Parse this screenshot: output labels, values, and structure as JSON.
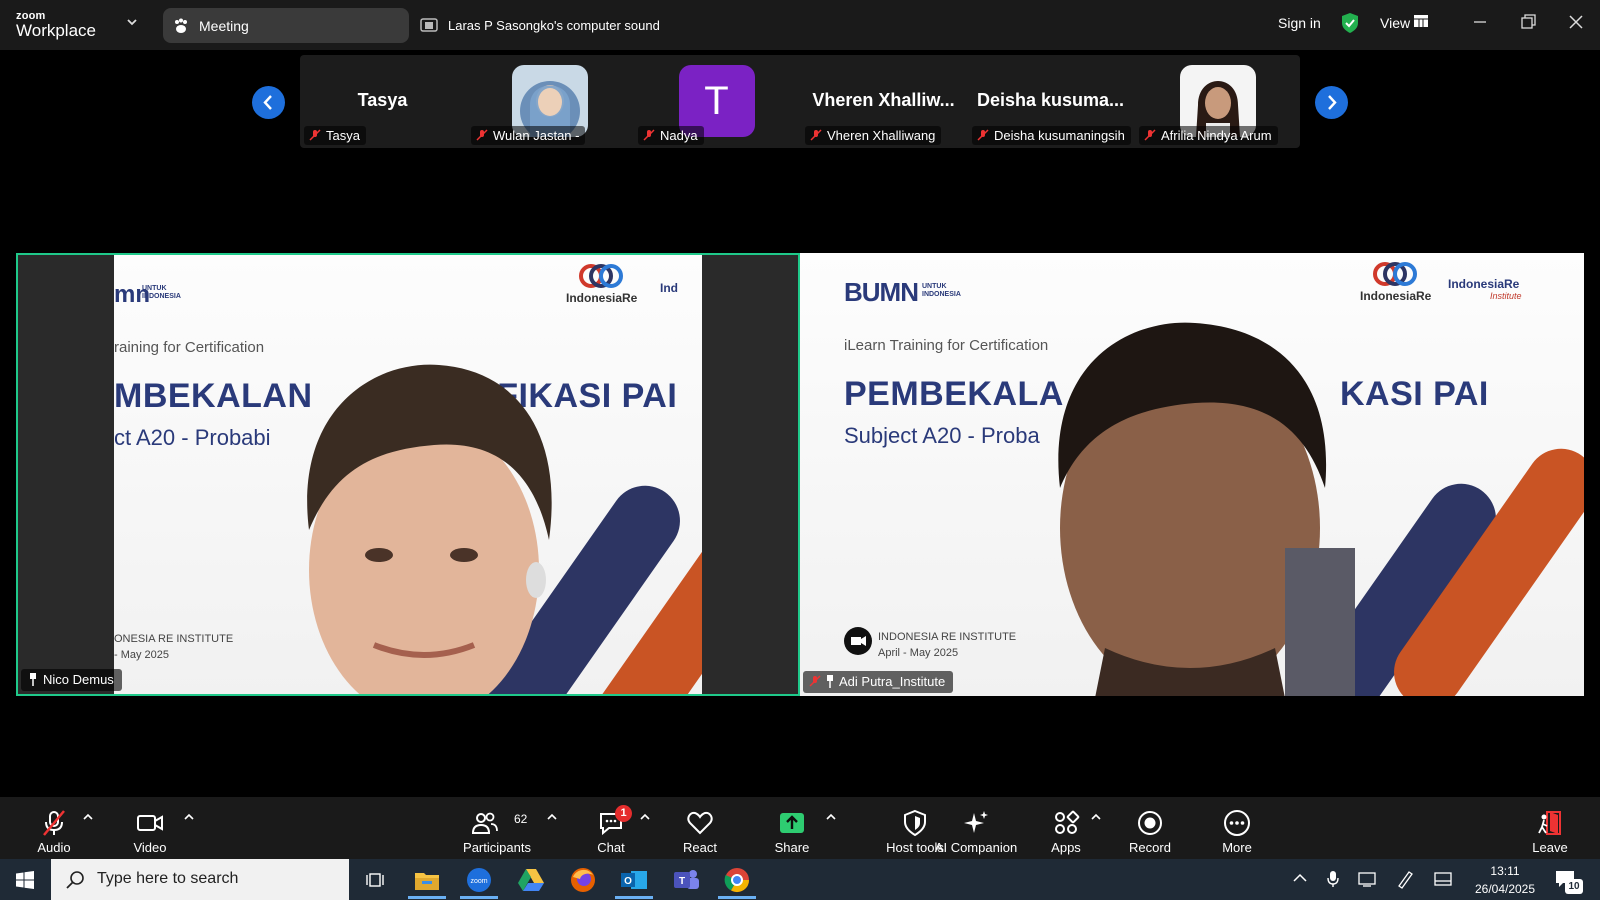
{
  "app": {
    "logo_small": "zoom",
    "logo_big": "Workplace",
    "meeting_label": "Meeting",
    "sound_label": "Laras P Sasongko's computer sound",
    "sign_in": "Sign in",
    "view": "View"
  },
  "filmstrip": [
    {
      "big": "Tasya",
      "name": "Tasya",
      "kind": "text"
    },
    {
      "big": "",
      "name": "Wulan Jastan -",
      "kind": "photo-hijab"
    },
    {
      "big": "T",
      "name": "Nadya",
      "kind": "letter"
    },
    {
      "big": "Vheren Xhalliw...",
      "name": "Vheren Xhalliwang",
      "kind": "text"
    },
    {
      "big": "Deisha kusuma...",
      "name": "Deisha kusumaningsih",
      "kind": "text"
    },
    {
      "big": "",
      "name": "Afrilia Nindya Arum",
      "kind": "photo-woman"
    }
  ],
  "videos": {
    "left": {
      "name": "Nico Demus",
      "logo": "IndonesiaRe",
      "logo_partial": "Ind",
      "bumn": "mn",
      "bumn_sub": "UNTUK\nINDONESIA",
      "cert": "raining for Certification",
      "title_a": "MBEKALAN",
      "title_b": "TIFIKASI PAI",
      "subject": "ct A20 - Probabi",
      "inst_1": "ONESIA RE INSTITUTE",
      "inst_2": "- May 2025"
    },
    "right": {
      "name": "Adi Putra_Institute",
      "logo": "IndonesiaRe",
      "logo2": "IndonesiaRe",
      "logo2_sub": "Institute",
      "bumn": "BUMN",
      "bumn_sub": "UNTUK\nINDONESIA",
      "cert": "iLearn Training for Certification",
      "title_a": "PEMBEKALA",
      "title_b": "KASI PAI",
      "subject": "Subject A20 - Proba",
      "inst_1": "INDONESIA RE INSTITUTE",
      "inst_2": "April - May 2025"
    }
  },
  "toolbar": {
    "audio": "Audio",
    "video": "Video",
    "participants": "Participants",
    "participants_count": "62",
    "chat": "Chat",
    "chat_badge": "1",
    "react": "React",
    "share": "Share",
    "host_tools": "Host tools",
    "ai_companion": "AI Companion",
    "apps": "Apps",
    "record": "Record",
    "more": "More",
    "leave": "Leave"
  },
  "taskbar": {
    "search_placeholder": "Type here to search",
    "time": "13:11",
    "date": "26/04/2025",
    "notif_count": "10"
  },
  "colors": {
    "active_speaker_border": "#1fc98a",
    "share_green": "#2ecc71",
    "accent_blue": "#1e6fdc",
    "slide_navy": "#2d3563",
    "slide_orange": "#c95424"
  }
}
